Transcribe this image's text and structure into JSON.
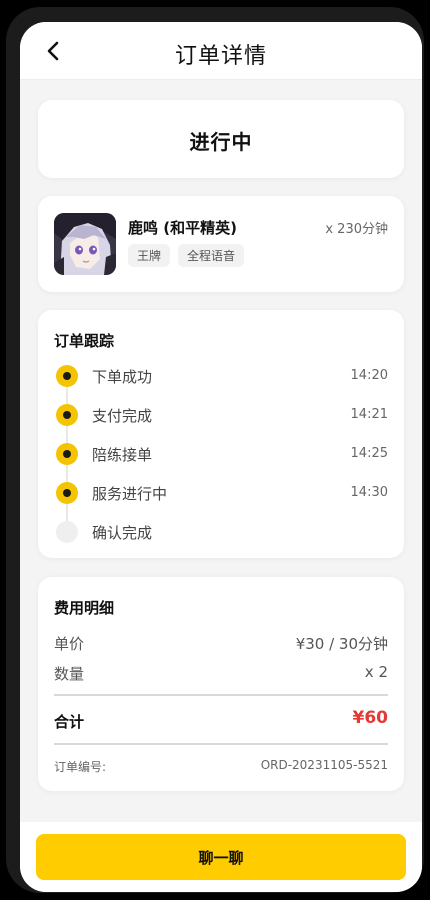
{
  "header": {
    "title": "订单详情",
    "back_icon": "chevron-left-icon"
  },
  "status": {
    "text": "进行中"
  },
  "product": {
    "name": "鹿鸣 (和平精英)",
    "quantity": "x 230分钟",
    "tags": [
      "王牌",
      "全程语音"
    ]
  },
  "tracking": {
    "title": "订单跟踪",
    "steps": [
      {
        "label": "下单成功",
        "time": "14:20",
        "done": true
      },
      {
        "label": "支付完成",
        "time": "14:21",
        "done": true
      },
      {
        "label": "陪练接单",
        "time": "14:25",
        "done": true
      },
      {
        "label": "服务进行中",
        "time": "14:30",
        "done": true
      },
      {
        "label": "确认完成",
        "time": "",
        "done": false
      }
    ]
  },
  "fees": {
    "title": "费用明细",
    "unit_price_label": "单价",
    "unit_price_value": "¥30 / 30分钟",
    "quantity_label": "数量",
    "quantity_value": "x 2",
    "total_label": "合计",
    "total_value": "¥60",
    "order_no_label": "订单编号:",
    "order_no_value": "ORD-20231105-5521"
  },
  "actions": {
    "chat_label": "聊一聊"
  },
  "colors": {
    "accent": "#ffcc00",
    "price": "#e53935",
    "dot_active": "#f5c400"
  }
}
